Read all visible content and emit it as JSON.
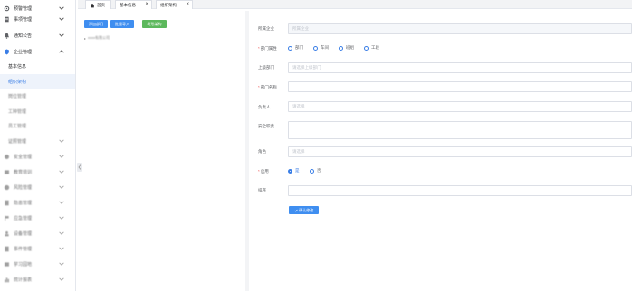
{
  "sidebar": {
    "items": [
      {
        "label": "预警管理",
        "icon": "gear-icon"
      },
      {
        "label": "事项管理",
        "icon": "document-icon"
      },
      {
        "label": "通知公告",
        "icon": "bell-icon"
      },
      {
        "label": "企业管理",
        "icon": "shield-icon"
      }
    ],
    "subitems": [
      {
        "label": "基本信息"
      },
      {
        "label": "组织架构"
      },
      {
        "label": "岗位管理"
      },
      {
        "label": "工种管理"
      },
      {
        "label": "员工管理"
      },
      {
        "label": "证照管理"
      }
    ],
    "more_items": [
      {
        "label": "安全管理"
      },
      {
        "label": "教育培训"
      },
      {
        "label": "风险管理"
      },
      {
        "label": "隐患管理"
      },
      {
        "label": "应急管理"
      },
      {
        "label": "设备管理"
      },
      {
        "label": "事件管理"
      },
      {
        "label": "学习园地"
      },
      {
        "label": "统计报表"
      }
    ]
  },
  "tabs": [
    {
      "label": "首页",
      "icon": "home-icon"
    },
    {
      "label": "基本信息"
    },
    {
      "label": "组织架构"
    }
  ],
  "toolbar": {
    "add_label": "添加部门",
    "import_label": "批量导入",
    "export_label": "树形架构"
  },
  "tree": {
    "root_label": "xxxx有限公司"
  },
  "form": {
    "company_label": "所属企业",
    "company_placeholder": "所属企业",
    "dept_type_label": "部门属性",
    "dept_type_options": [
      "部门",
      "车间",
      "班组",
      "工段"
    ],
    "parent_label": "上级部门",
    "parent_placeholder": "请选择上级部门",
    "dept_name_label": "部门名称",
    "leader_label": "负责人",
    "leader_placeholder": "请选择",
    "safety_duty_label": "安全职责",
    "role_label": "角色",
    "role_placeholder": "请选择",
    "enabled_label": "启用",
    "enabled_options": [
      "是",
      "否"
    ],
    "enabled_selected": "是",
    "order_label": "排序",
    "submit_label": "确认修改"
  },
  "colors": {
    "primary": "#3f8ef0",
    "success": "#5cb85c",
    "active_bg": "#eef3fb"
  }
}
